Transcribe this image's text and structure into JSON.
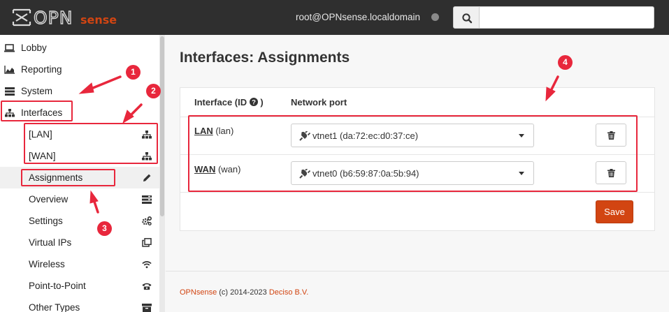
{
  "header": {
    "logo_text": "OPNsense",
    "user": "root@OPNsense.localdomain",
    "search_placeholder": ""
  },
  "sidebar": {
    "items": [
      {
        "label": "Lobby",
        "icon": "laptop-icon"
      },
      {
        "label": "Reporting",
        "icon": "area-chart-icon"
      },
      {
        "label": "System",
        "icon": "server-icon"
      },
      {
        "label": "Interfaces",
        "icon": "sitemap-icon"
      }
    ],
    "sub_items": [
      {
        "label": "[LAN]",
        "icon": "sitemap-icon"
      },
      {
        "label": "[WAN]",
        "icon": "sitemap-icon"
      },
      {
        "label": "Assignments",
        "icon": "pencil-icon"
      },
      {
        "label": "Overview",
        "icon": "tasks-icon"
      },
      {
        "label": "Settings",
        "icon": "cogs-icon"
      },
      {
        "label": "Virtual IPs",
        "icon": "clone-icon"
      },
      {
        "label": "Wireless",
        "icon": "wifi-icon"
      },
      {
        "label": "Point-to-Point",
        "icon": "phone-icon"
      },
      {
        "label": "Other Types",
        "icon": "archive-icon"
      }
    ]
  },
  "main": {
    "title": "Interfaces: Assignments",
    "table": {
      "col_interface": "Interface (ID",
      "col_interface_suffix": ")",
      "col_port": "Network port",
      "rows": [
        {
          "name": "LAN",
          "id": "(lan)",
          "port": "vtnet1 (da:72:ec:d0:37:ce)"
        },
        {
          "name": "WAN",
          "id": "(wan)",
          "port": "vtnet0 (b6:59:87:0a:5b:94)"
        }
      ]
    },
    "save_label": "Save"
  },
  "footer": {
    "brand": "OPNsense",
    "copyright": "(c) 2014-2023",
    "company": "Deciso B.V."
  },
  "annotations": {
    "badges": [
      "1",
      "2",
      "3",
      "4"
    ],
    "color": "#e8273c"
  },
  "colors": {
    "topbar": "#2f2f2f",
    "accent": "#d24512"
  }
}
